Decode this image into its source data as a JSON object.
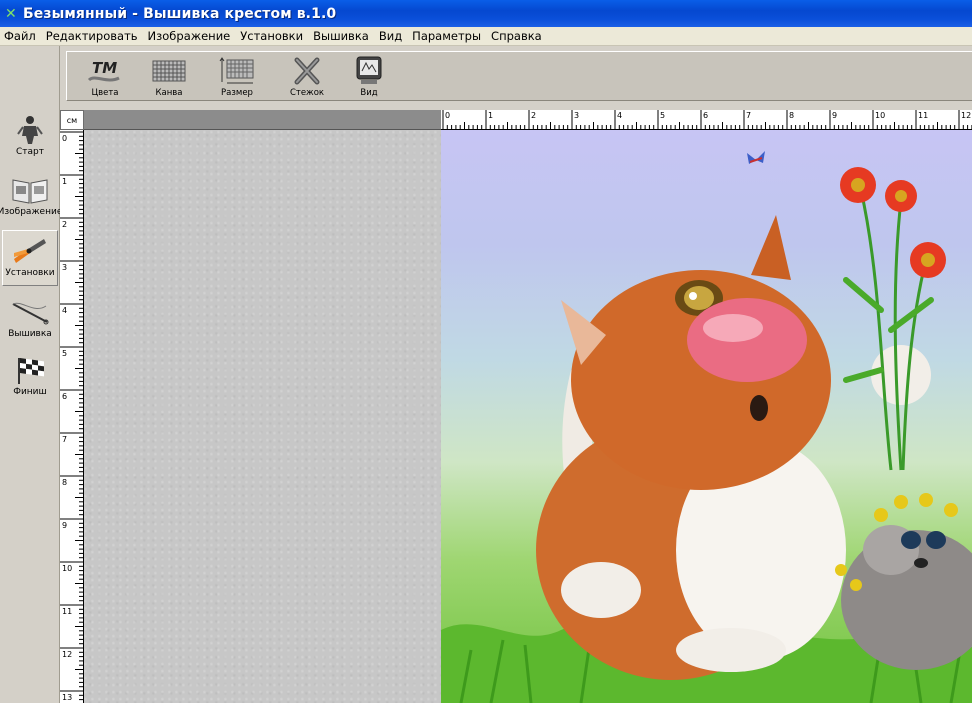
{
  "window": {
    "title": "Безымянный - Вышивка крестом в.1.0"
  },
  "menu": [
    "Файл",
    "Редактировать",
    "Изображение",
    "Установки",
    "Вышивка",
    "Вид",
    "Параметры",
    "Справка"
  ],
  "toolbar": {
    "items": [
      {
        "label": "Цвета",
        "icon": "colors-tm-icon"
      },
      {
        "label": "Канва",
        "icon": "canvas-grid-icon"
      },
      {
        "label": "Размер",
        "icon": "size-icon"
      },
      {
        "label": "Стежок",
        "icon": "stitch-icon"
      },
      {
        "label": "Вид",
        "icon": "view-monitor-icon"
      }
    ]
  },
  "sidebar": {
    "items": [
      {
        "label": "Старт",
        "icon": "start-figure-icon"
      },
      {
        "label": "Изображение",
        "icon": "image-book-icon"
      },
      {
        "label": "Установки",
        "icon": "settings-pliers-icon"
      },
      {
        "label": "Вышивка",
        "icon": "embroidery-needle-icon"
      },
      {
        "label": "Финиш",
        "icon": "finish-flag-icon"
      }
    ]
  },
  "ruler": {
    "unit": "см",
    "top_numbers": [
      "0",
      "1",
      "2",
      "3",
      "4",
      "5",
      "6",
      "7",
      "8",
      "9",
      "10",
      "11",
      "12"
    ],
    "left_numbers": [
      "0",
      "1",
      "2",
      "3",
      "4",
      "5",
      "6",
      "7",
      "8",
      "9",
      "10",
      "11",
      "12",
      "13"
    ]
  },
  "colors": {
    "titlebar": "#0548d0",
    "menubar": "#ece9d8",
    "panel": "#d4d0c8",
    "canvas_gray": "#c7c7c7"
  }
}
